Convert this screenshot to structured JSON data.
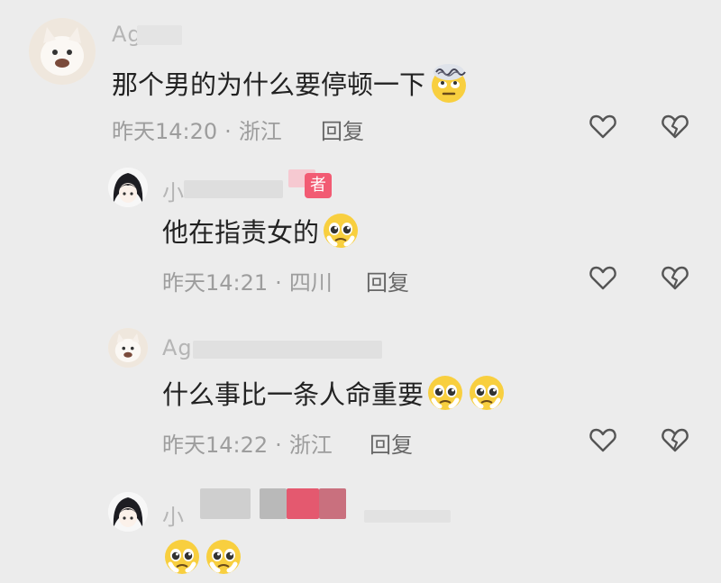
{
  "comments": [
    {
      "author": "Ag",
      "text": "那个男的为什么要停顿一下",
      "time": "昨天14:20",
      "location": "浙江",
      "reply_label": "回复",
      "emoji": [
        "dizzy-eyeroll"
      ]
    },
    {
      "author": "小",
      "badge": "者",
      "text": "他在指责女的",
      "time": "昨天14:21",
      "location": "四川",
      "reply_label": "回复",
      "emoji": [
        "pleading"
      ]
    },
    {
      "author": "Ag",
      "text": "什么事比一条人命重要",
      "time": "昨天14:22",
      "location": "浙江",
      "reply_label": "回复",
      "emoji": [
        "pleading",
        "pleading"
      ]
    },
    {
      "author": "小",
      "text": "",
      "emoji": [
        "pleading",
        "pleading"
      ]
    }
  ],
  "separator": "·",
  "icons": {
    "like": "heart-outline-icon",
    "dislike": "broken-heart-icon"
  },
  "colors": {
    "background": "#ececec",
    "meta": "#9d9d9d",
    "badge": "#f25b73"
  }
}
